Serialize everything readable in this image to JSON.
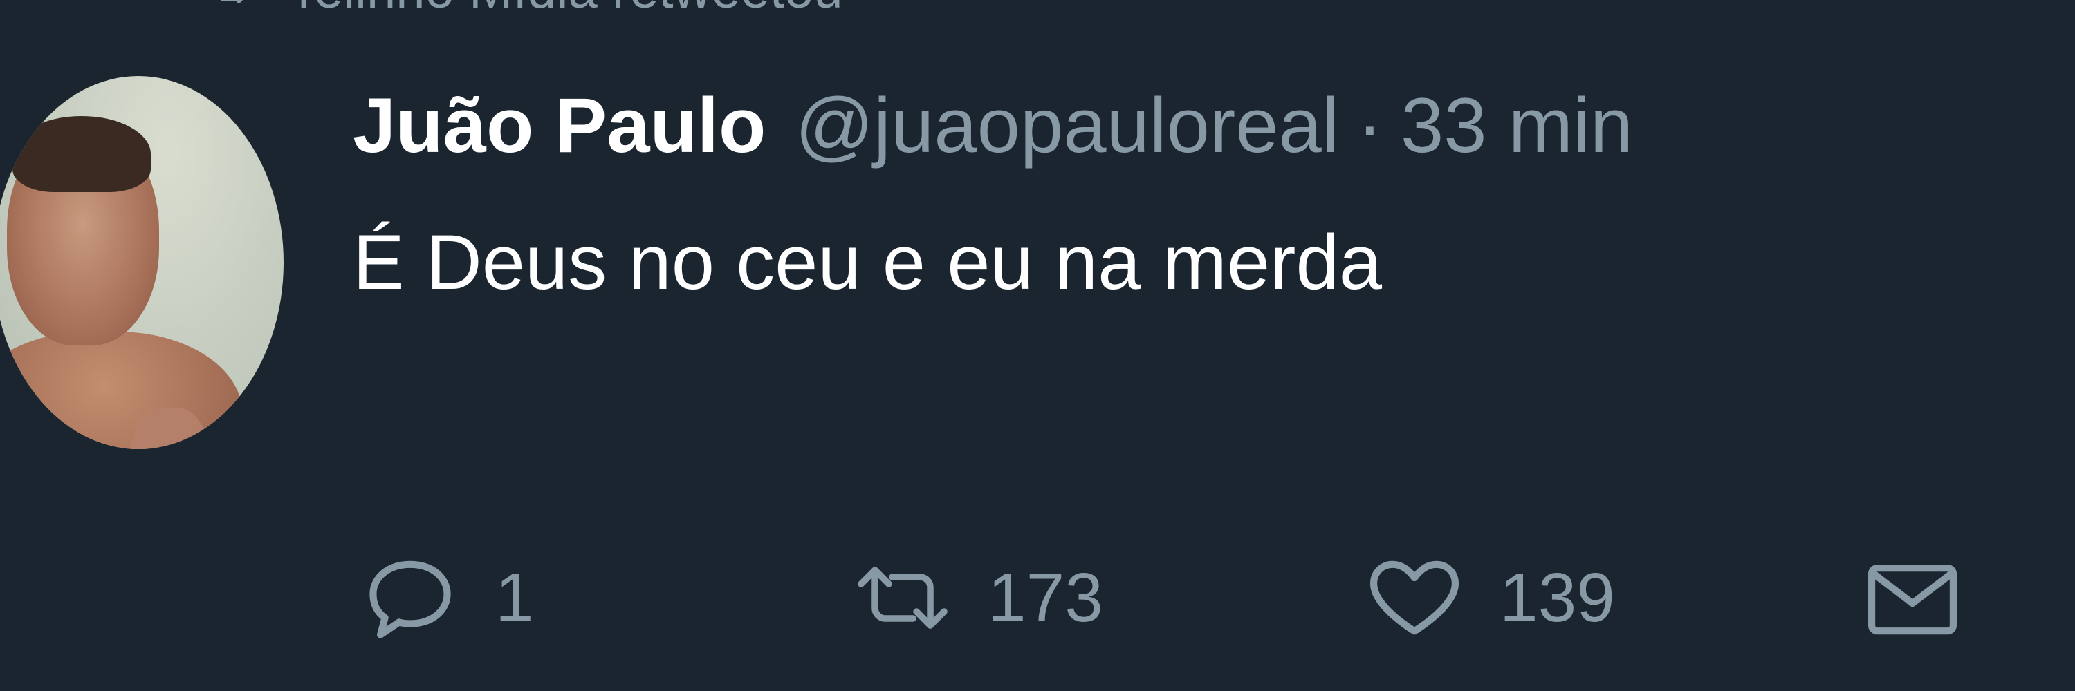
{
  "retweet_context": {
    "text": "Telinho Mídia retweetou",
    "icon": "retweet-icon"
  },
  "tweet": {
    "author_name": "Juão Paulo",
    "author_handle": "@juaopauloreal",
    "separator": "·",
    "time": "33 min",
    "text": "É Deus no ceu e eu na merda",
    "avatar_icon": "avatar"
  },
  "actions": {
    "reply": {
      "icon": "reply-icon",
      "count": "1"
    },
    "retweet": {
      "icon": "retweet-icon",
      "count": "173"
    },
    "like": {
      "icon": "heart-icon",
      "count": "139"
    },
    "direct_message": {
      "icon": "envelope-icon"
    }
  },
  "colors": {
    "background": "#1b2530",
    "primary_text": "#ffffff",
    "secondary_text": "#8899a6"
  }
}
